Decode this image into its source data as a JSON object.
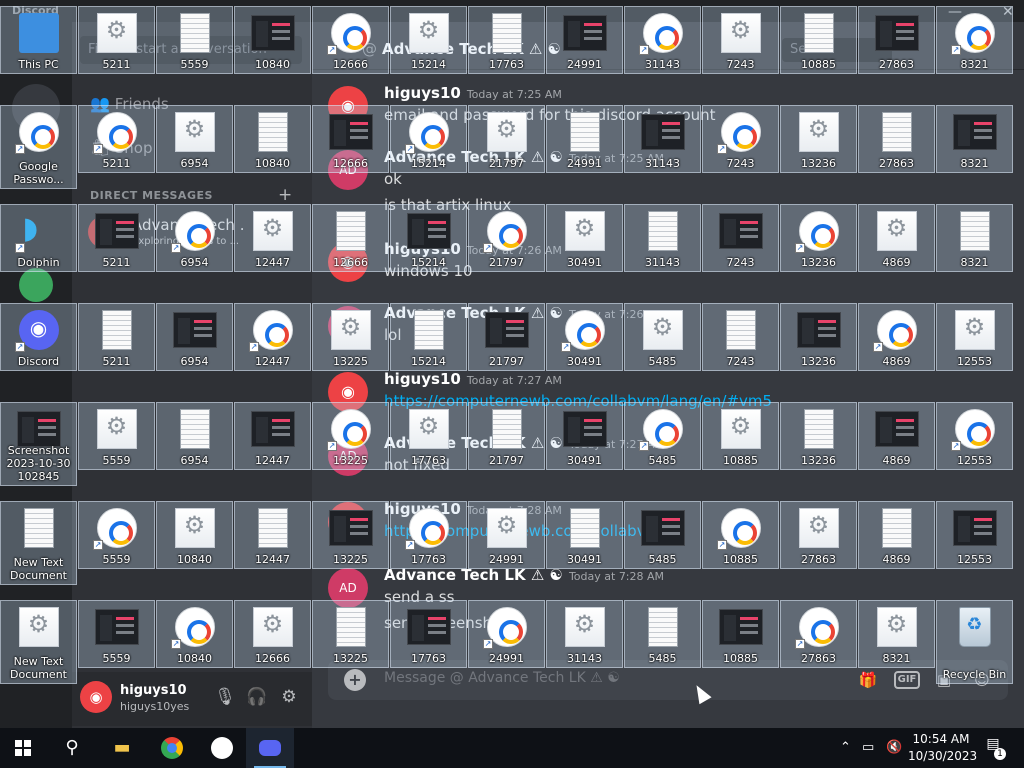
{
  "discord": {
    "title": "Discord",
    "search_placeholder": "Find or start a conversation",
    "nav": [
      {
        "label": "Friends",
        "icon": "friends-icon"
      },
      {
        "label": "Shop",
        "icon": "shop-icon"
      }
    ],
    "dm_header": "DIRECT MESSAGES",
    "dm_item": {
      "name": "Advance Tech .",
      "status": "Exploring things to ..."
    },
    "channel_name": "Advance Tech LK ⚠ ☯",
    "chat_search": "Search",
    "user": {
      "name": "higuys10",
      "tag": "higuys10yes"
    },
    "messages": [
      {
        "author": "higuys10",
        "time": "Today at 7:25 AM",
        "lines": [
          {
            "text": "email and password for this discord account",
            "link": false
          }
        ],
        "reply": false
      },
      {
        "author": "Advance Tech LK ⚠ ☯",
        "time": "Today at 7:25 AM",
        "lines": [
          {
            "text": "ok",
            "link": false
          },
          {
            "text": "is that artix linux",
            "link": false
          }
        ],
        "reply": true
      },
      {
        "author": "higuys10",
        "time": "Today at 7:26 AM",
        "lines": [
          {
            "text": "windows 10",
            "link": false
          }
        ],
        "reply": false
      },
      {
        "author": "Advance Tech LK ⚠ ☯",
        "time": "Today at 7:26 AM",
        "lines": [
          {
            "text": "lol",
            "link": false
          }
        ],
        "reply": true
      },
      {
        "author": "higuys10",
        "time": "Today at 7:27 AM",
        "lines": [
          {
            "text": "https://computernewb.com/collabvm/lang/en/#vm5",
            "link": true
          }
        ],
        "reply": false
      },
      {
        "author": "Advance Tech LK ⚠ ☯",
        "time": "Today at 7:27 AM",
        "lines": [
          {
            "text": "not fixed",
            "link": false
          }
        ],
        "reply": true
      },
      {
        "author": "higuys10",
        "time": "Today at 7:28 AM",
        "lines": [
          {
            "text": "https://computernewb.com/collabvm",
            "link": true
          }
        ],
        "reply": false
      },
      {
        "author": "Advance Tech LK ⚠ ☯",
        "time": "Today at 7:28 AM",
        "lines": [
          {
            "text": "send a ss",
            "link": false
          },
          {
            "text": "send screenshot",
            "link": false
          }
        ],
        "reply": true
      }
    ],
    "composer_placeholder": "Message @ Advance Tech LK ⚠ ☯",
    "composer_icons": [
      "gift-icon",
      "gif-icon",
      "sticker-icon",
      "emoji-icon"
    ]
  },
  "desktop": {
    "rows": [
      [
        {
          "label": "This PC",
          "type": "pc",
          "shortcut": false
        },
        {
          "label": "5211",
          "type": "gear",
          "shortcut": false
        },
        {
          "label": "5559",
          "type": "doc",
          "shortcut": false
        },
        {
          "label": "10840",
          "type": "shot",
          "shortcut": false
        },
        {
          "label": "12666",
          "type": "key",
          "shortcut": true
        },
        {
          "label": "15214",
          "type": "gear",
          "shortcut": false
        },
        {
          "label": "17763",
          "type": "doc",
          "shortcut": false
        },
        {
          "label": "24991",
          "type": "shot",
          "shortcut": false
        },
        {
          "label": "31143",
          "type": "key",
          "shortcut": true
        },
        {
          "label": "7243",
          "type": "gear",
          "shortcut": false
        },
        {
          "label": "10885",
          "type": "doc",
          "shortcut": false
        },
        {
          "label": "27863",
          "type": "shot",
          "shortcut": false
        },
        {
          "label": "8321",
          "type": "key",
          "shortcut": true
        }
      ],
      [
        {
          "label": "Google Passwo...",
          "type": "key",
          "shortcut": true
        },
        {
          "label": "5211",
          "type": "key",
          "shortcut": true
        },
        {
          "label": "6954",
          "type": "gear",
          "shortcut": false
        },
        {
          "label": "10840",
          "type": "doc",
          "shortcut": false
        },
        {
          "label": "12666",
          "type": "shot",
          "shortcut": false
        },
        {
          "label": "15214",
          "type": "key",
          "shortcut": true
        },
        {
          "label": "21797",
          "type": "gear",
          "shortcut": false
        },
        {
          "label": "24991",
          "type": "doc",
          "shortcut": false
        },
        {
          "label": "31143",
          "type": "shot",
          "shortcut": false
        },
        {
          "label": "7243",
          "type": "key",
          "shortcut": true
        },
        {
          "label": "13236",
          "type": "gear",
          "shortcut": false
        },
        {
          "label": "27863",
          "type": "doc",
          "shortcut": false
        },
        {
          "label": "8321",
          "type": "shot",
          "shortcut": false
        }
      ],
      [
        {
          "label": "Dolphin",
          "type": "dolphin",
          "shortcut": true
        },
        {
          "label": "5211",
          "type": "shot",
          "shortcut": false
        },
        {
          "label": "6954",
          "type": "key",
          "shortcut": true
        },
        {
          "label": "12447",
          "type": "gear",
          "shortcut": false
        },
        {
          "label": "12666",
          "type": "doc",
          "shortcut": false
        },
        {
          "label": "15214",
          "type": "shot",
          "shortcut": false
        },
        {
          "label": "21797",
          "type": "key",
          "shortcut": true
        },
        {
          "label": "30491",
          "type": "gear",
          "shortcut": false
        },
        {
          "label": "31143",
          "type": "doc",
          "shortcut": false
        },
        {
          "label": "7243",
          "type": "shot",
          "shortcut": false
        },
        {
          "label": "13236",
          "type": "key",
          "shortcut": true
        },
        {
          "label": "4869",
          "type": "gear",
          "shortcut": false
        },
        {
          "label": "8321",
          "type": "doc",
          "shortcut": false
        }
      ],
      [
        {
          "label": "Discord",
          "type": "discord",
          "shortcut": true
        },
        {
          "label": "5211",
          "type": "doc",
          "shortcut": false
        },
        {
          "label": "6954",
          "type": "shot",
          "shortcut": false
        },
        {
          "label": "12447",
          "type": "key",
          "shortcut": true
        },
        {
          "label": "13225",
          "type": "gear",
          "shortcut": false
        },
        {
          "label": "15214",
          "type": "doc",
          "shortcut": false
        },
        {
          "label": "21797",
          "type": "shot",
          "shortcut": false
        },
        {
          "label": "30491",
          "type": "key",
          "shortcut": true
        },
        {
          "label": "5485",
          "type": "gear",
          "shortcut": false
        },
        {
          "label": "7243",
          "type": "doc",
          "shortcut": false
        },
        {
          "label": "13236",
          "type": "shot",
          "shortcut": false
        },
        {
          "label": "4869",
          "type": "key",
          "shortcut": true
        },
        {
          "label": "12553",
          "type": "gear",
          "shortcut": false
        }
      ],
      [
        {
          "label": "Screenshot 2023-10-30 102845",
          "type": "shot",
          "shortcut": false
        },
        {
          "label": "5559",
          "type": "gear",
          "shortcut": false
        },
        {
          "label": "6954",
          "type": "doc",
          "shortcut": false
        },
        {
          "label": "12447",
          "type": "shot",
          "shortcut": false
        },
        {
          "label": "13225",
          "type": "key",
          "shortcut": true
        },
        {
          "label": "17763",
          "type": "gear",
          "shortcut": false
        },
        {
          "label": "21797",
          "type": "doc",
          "shortcut": false
        },
        {
          "label": "30491",
          "type": "shot",
          "shortcut": false
        },
        {
          "label": "5485",
          "type": "key",
          "shortcut": true
        },
        {
          "label": "10885",
          "type": "gear",
          "shortcut": false
        },
        {
          "label": "13236",
          "type": "doc",
          "shortcut": false
        },
        {
          "label": "4869",
          "type": "shot",
          "shortcut": false
        },
        {
          "label": "12553",
          "type": "key",
          "shortcut": true
        }
      ],
      [
        {
          "label": "New Text Document",
          "type": "doc",
          "shortcut": false
        },
        {
          "label": "5559",
          "type": "key",
          "shortcut": true
        },
        {
          "label": "10840",
          "type": "gear",
          "shortcut": false
        },
        {
          "label": "12447",
          "type": "doc",
          "shortcut": false
        },
        {
          "label": "13225",
          "type": "shot",
          "shortcut": false
        },
        {
          "label": "17763",
          "type": "key",
          "shortcut": true
        },
        {
          "label": "24991",
          "type": "gear",
          "shortcut": false
        },
        {
          "label": "30491",
          "type": "doc",
          "shortcut": false
        },
        {
          "label": "5485",
          "type": "shot",
          "shortcut": false
        },
        {
          "label": "10885",
          "type": "key",
          "shortcut": true
        },
        {
          "label": "27863",
          "type": "gear",
          "shortcut": false
        },
        {
          "label": "4869",
          "type": "doc",
          "shortcut": false
        },
        {
          "label": "12553",
          "type": "shot",
          "shortcut": false
        }
      ],
      [
        {
          "label": "New Text Document",
          "type": "gear",
          "shortcut": false
        },
        {
          "label": "5559",
          "type": "shot",
          "shortcut": false
        },
        {
          "label": "10840",
          "type": "key",
          "shortcut": true
        },
        {
          "label": "12666",
          "type": "gear",
          "shortcut": false
        },
        {
          "label": "13225",
          "type": "doc",
          "shortcut": false
        },
        {
          "label": "17763",
          "type": "shot",
          "shortcut": false
        },
        {
          "label": "24991",
          "type": "key",
          "shortcut": true
        },
        {
          "label": "31143",
          "type": "gear",
          "shortcut": false
        },
        {
          "label": "5485",
          "type": "doc",
          "shortcut": false
        },
        {
          "label": "10885",
          "type": "shot",
          "shortcut": false
        },
        {
          "label": "27863",
          "type": "key",
          "shortcut": true
        },
        {
          "label": "8321",
          "type": "gear",
          "shortcut": false
        },
        {
          "label": "Recycle Bin",
          "type": "bin",
          "shortcut": false
        }
      ]
    ]
  },
  "taskbar": {
    "apps": [
      {
        "name": "start-button",
        "icon": "windows-icon"
      },
      {
        "name": "search-button",
        "icon": "search-icon"
      },
      {
        "name": "file-explorer",
        "icon": "folder-icon"
      },
      {
        "name": "chrome",
        "icon": "chrome-icon"
      },
      {
        "name": "google-password-manager",
        "icon": "key-icon"
      },
      {
        "name": "discord",
        "icon": "discord-icon"
      }
    ],
    "time": "10:54 AM",
    "date": "10/30/2023",
    "notification_count": "1"
  }
}
